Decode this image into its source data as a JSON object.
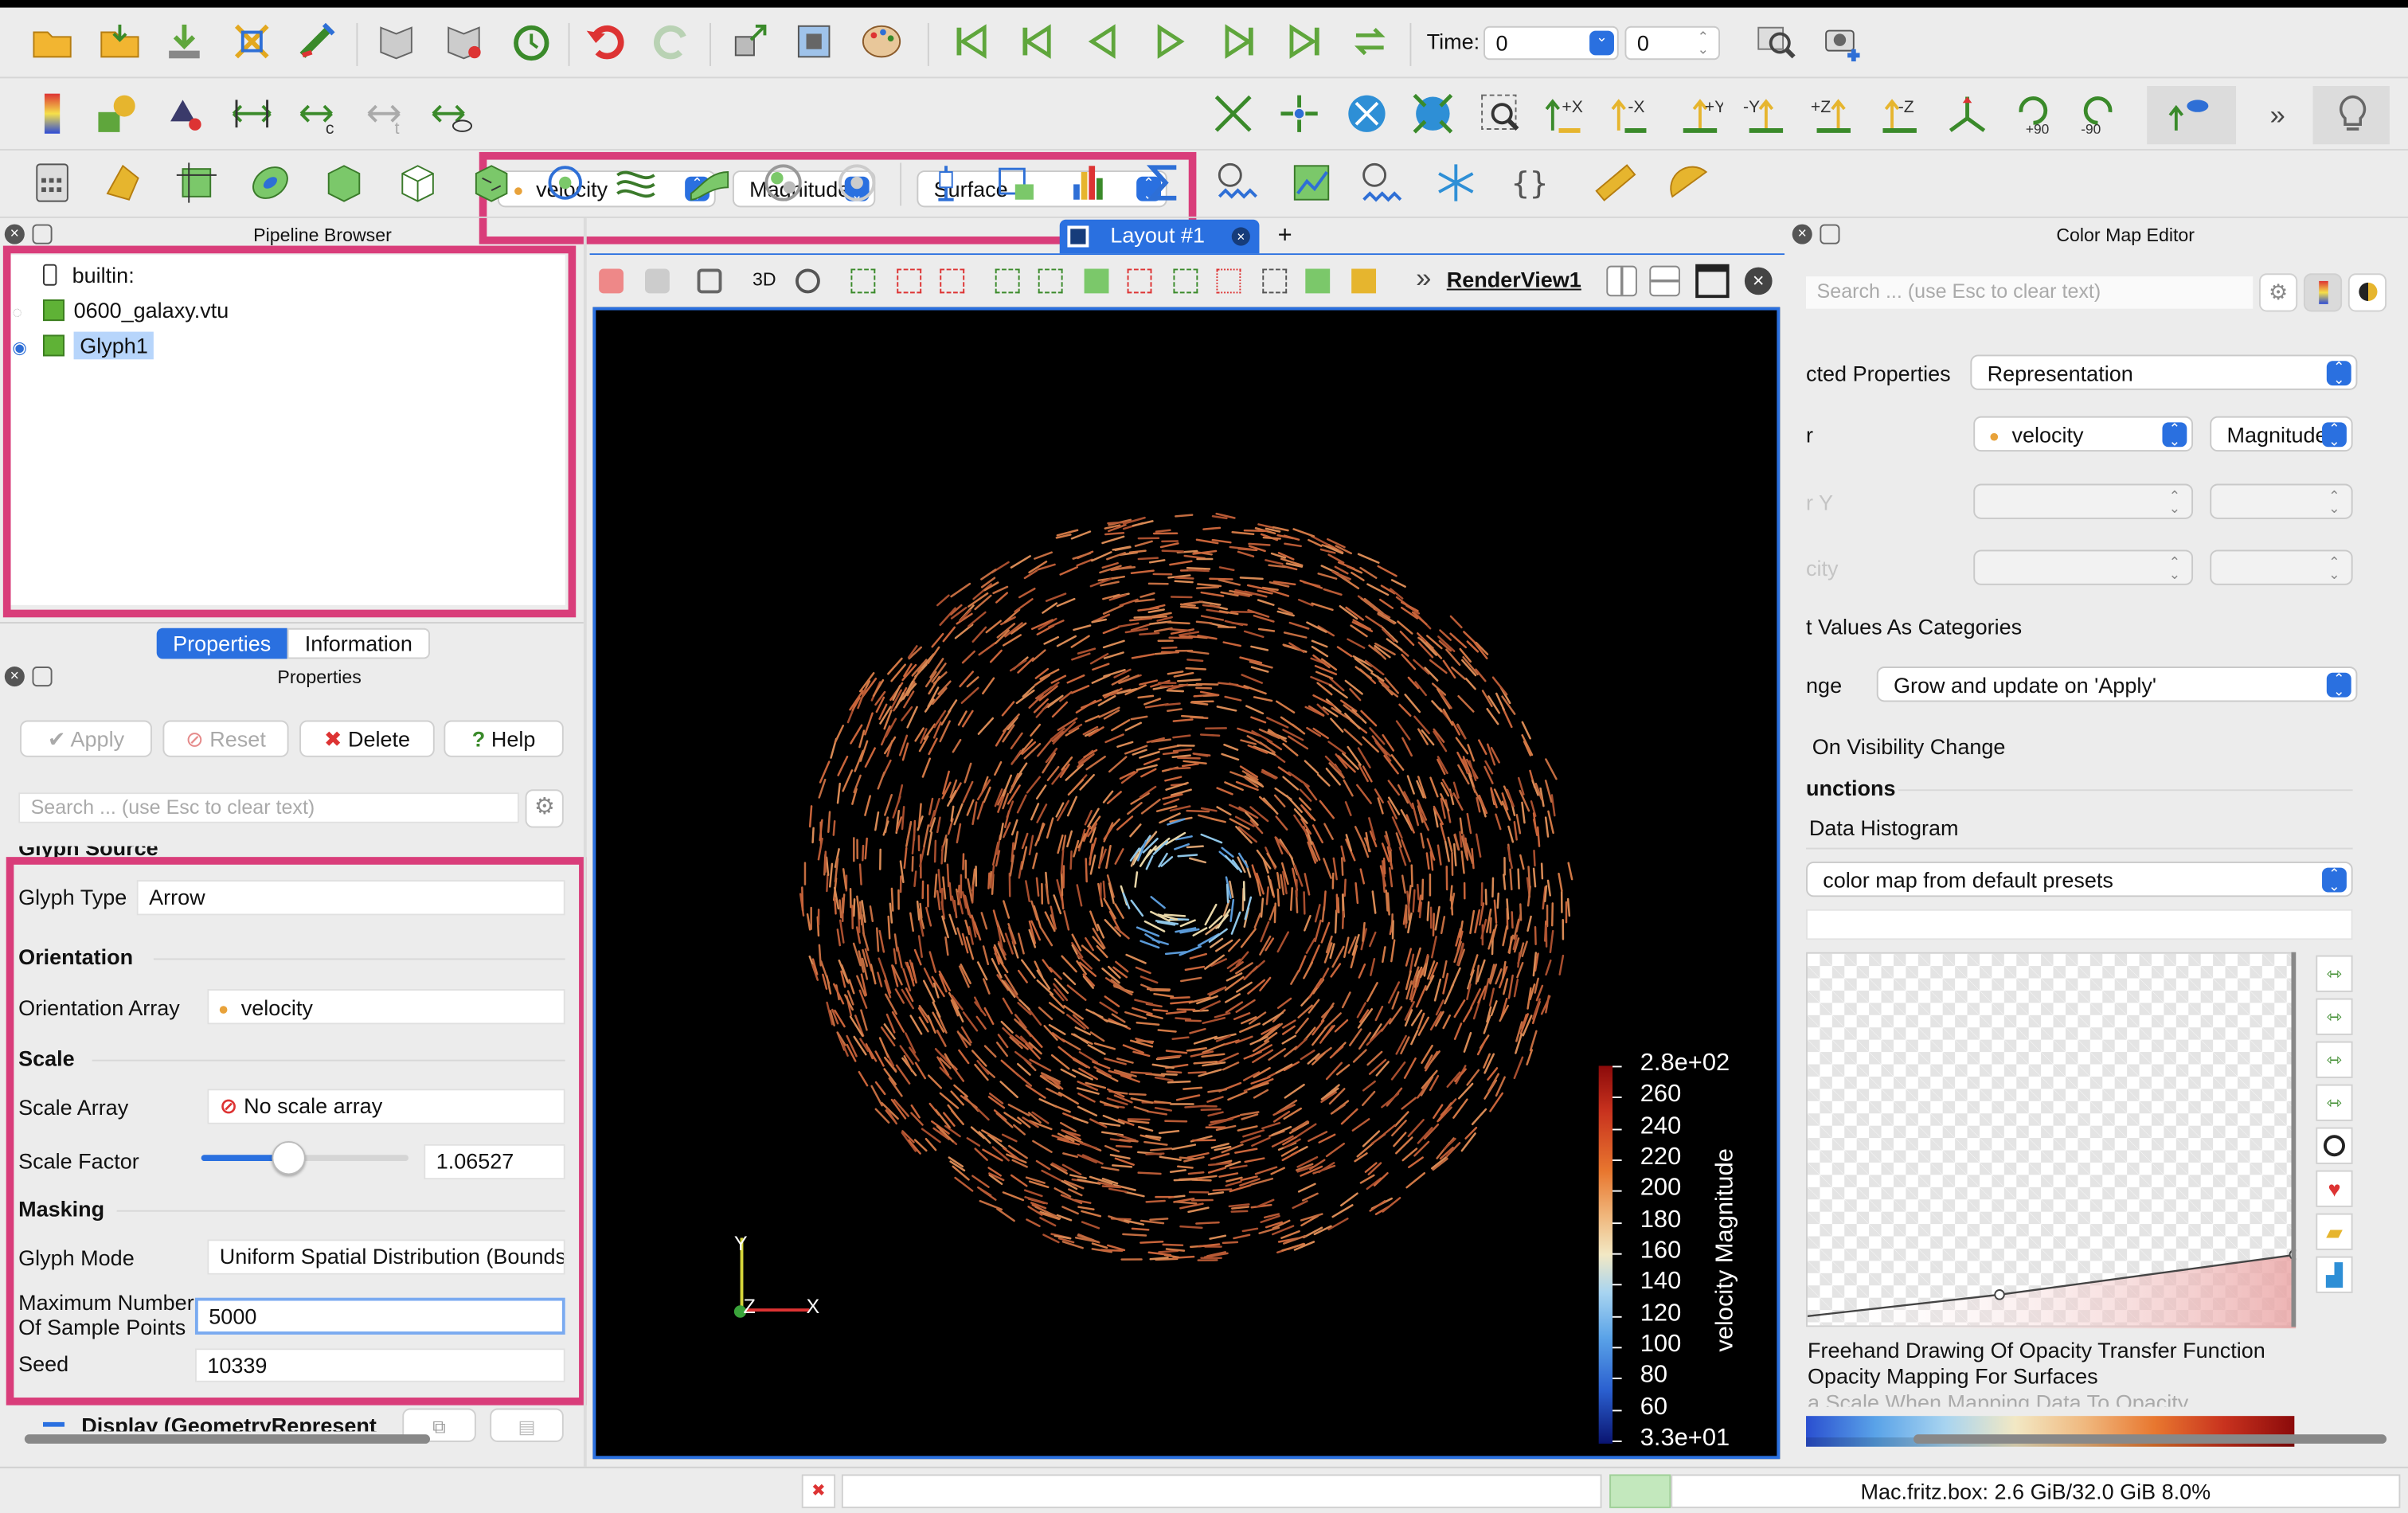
{
  "toolbar": {
    "time_label": "Time:",
    "time_value": "0",
    "time_step": "0",
    "color_array": "velocity",
    "color_component": "Magnitude",
    "representation": "Surface",
    "icons": [
      "open-icon",
      "save-icon",
      "download-icon",
      "connect-icon",
      "macro-icon",
      "undo-icon",
      "redo-icon",
      "first-frame-icon",
      "prev-frame-icon",
      "play-back-icon",
      "play-icon",
      "next-frame-icon",
      "last-frame-icon",
      "loop-icon"
    ],
    "camera": {
      "plus_x": "+X",
      "minus_x": "-X",
      "plus_y": "+Y",
      "minus_y": "-Y",
      "plus_z": "+Z",
      "minus_z": "-Z",
      "rot_plus": "+90",
      "rot_minus": "-90"
    }
  },
  "pipeline": {
    "title": "Pipeline Browser",
    "items": [
      {
        "label": "builtin:"
      },
      {
        "label": "0600_galaxy.vtu"
      },
      {
        "label": "Glyph1"
      }
    ]
  },
  "properties": {
    "tabs": [
      "Properties",
      "Information"
    ],
    "title": "Properties",
    "apply": "Apply",
    "reset": "Reset",
    "delete": "Delete",
    "help": "Help",
    "search_placeholder": "Search ... (use Esc to clear text)",
    "glyph_source": "Glyph Source",
    "glyph_type_label": "Glyph Type",
    "glyph_type_value": "Arrow",
    "orientation_section": "Orientation",
    "orientation_array_label": "Orientation Array",
    "orientation_array_value": "velocity",
    "scale_section": "Scale",
    "scale_array_label": "Scale Array",
    "scale_array_value": "No scale array",
    "scale_factor_label": "Scale Factor",
    "scale_factor_value": "1.06527",
    "scale_factor_slider": 0.42,
    "masking_section": "Masking",
    "glyph_mode_label": "Glyph Mode",
    "glyph_mode_value": "Uniform Spatial Distribution (Bounds",
    "max_points_label_1": "Maximum Number",
    "max_points_label_2": "Of Sample Points",
    "max_points_value": "5000",
    "seed_label": "Seed",
    "seed_value": "10339",
    "display_section": "Display (GeometryRepresent"
  },
  "layout": {
    "tab_label": "Layout #1",
    "add_tab": "+",
    "render_view": "RenderView1",
    "mode_3d": "3D"
  },
  "render": {
    "background": "#000000",
    "legend_title": "velocity Magnitude",
    "legend_ticks": [
      "2.8e+02",
      "260",
      "240",
      "220",
      "200",
      "180",
      "160",
      "140",
      "120",
      "100",
      "80",
      "60",
      "3.3e+01"
    ],
    "axis_y": "Y",
    "axis_z": "Z",
    "axis_x": "X"
  },
  "colormap": {
    "title": "Color Map Editor",
    "search_placeholder": "Search ... (use Esc to clear text)",
    "selected_props_label": "cted Properties",
    "selected_props_value": "Representation",
    "color_label": "r",
    "color_array": "velocity",
    "color_component": "Magnitude",
    "row_y_label": "r Y",
    "opacity_label": "city",
    "categories": "t Values As Categories",
    "range_label": "nge",
    "range_value": "Grow and update on 'Apply'",
    "visibility_change": "On Visibility Change",
    "functions_section": "unctions",
    "data_histogram": "Data Histogram",
    "preset_value": "color map from default presets",
    "freehand": "Freehand Drawing Of Opacity Transfer Function",
    "opacity_surfaces": "Opacity Mapping For Surfaces",
    "scale_mapping": "a Scale When Mapping Data To Opacity"
  },
  "status": {
    "memory": "Mac.fritz.box: 2.6 GiB/32.0 GiB 8.0%"
  },
  "colors": {
    "highlight": "#d93d7a",
    "accent": "#2a70e0",
    "selection": "#b7d5fb"
  }
}
